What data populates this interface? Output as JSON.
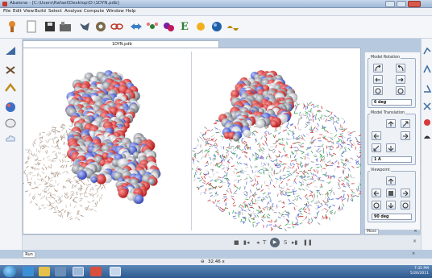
{
  "window": {
    "title": "Abalone - [C:\\Users\\Rafael\\Desktop\\D:\\1DYN.pdb]"
  },
  "menu": [
    "File",
    "Edit",
    "View",
    "Build",
    "Select",
    "Analyse",
    "Compute",
    "Window",
    "Help"
  ],
  "document": {
    "tab_label": "1DYN.pdb"
  },
  "toolbar": {
    "icons": [
      "new-molecule-icon",
      "blank-document-icon",
      "save-icon",
      "open-workspace-icon",
      "fragment-icon",
      "settings-wheel-icon",
      "link-icon",
      "move-arrows-icon",
      "atom-icon",
      "atom-cluster-icon",
      "energy-E-icon",
      "minimize-icon",
      "sphere-icon",
      "dynamics-icon"
    ]
  },
  "side_tools": {
    "left": [
      "draw-triangle-icon",
      "bond-tool-icon",
      "measure-tool-icon",
      "atom-select-icon",
      "ellipse-tool-icon",
      "cloud-tool-icon"
    ],
    "right": [
      "chart-icon",
      "torsion-icon",
      "angle-icon",
      "dihedral-icon",
      "sphere-color-icon",
      "surface-icon"
    ]
  },
  "model_rotation": {
    "title": "Model Rotation",
    "step": "6 deg"
  },
  "model_translation": {
    "title": "Model Translation",
    "step": "1 A"
  },
  "viewpoint": {
    "title": "Viewpoint",
    "step": "90 deg"
  },
  "panel_tab": "Move",
  "playback": {
    "buttons": [
      "stop",
      "first",
      "previous",
      "text",
      "play",
      "step",
      "next",
      "pause"
    ]
  },
  "bottom_tab": "Run",
  "status": {
    "zoom": "32.46 x"
  },
  "tray": {
    "time": "7:35 PM",
    "date": "5/26/2011"
  },
  "colors": {
    "oxygen": "#d63a3a",
    "nitrogen": "#5b6fe0",
    "carbon": "#9aa0a8",
    "hydrogen": "#f3f3f3"
  }
}
